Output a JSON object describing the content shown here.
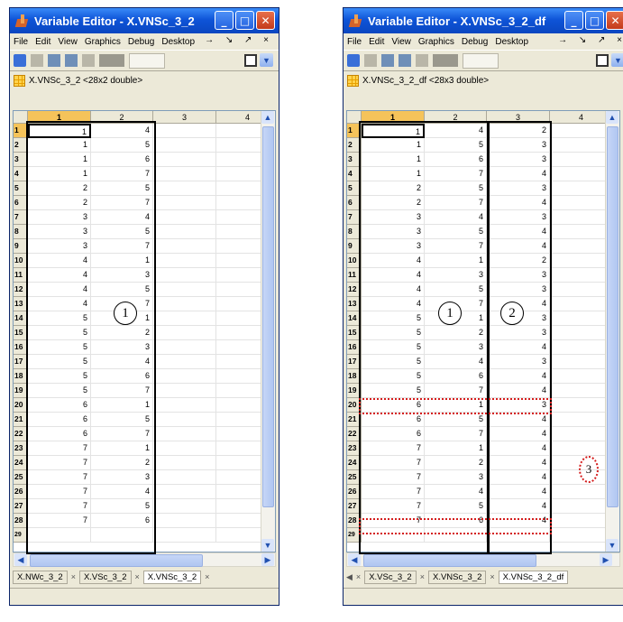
{
  "left": {
    "title": "Variable Editor - X.VNSc_3_2",
    "menu": [
      "File",
      "Edit",
      "View",
      "Graphics",
      "Debug",
      "Desktop"
    ],
    "menu_right": "→ ↘ ↗ ×",
    "var_desc": "X.VNSc_3_2 <28x2 double>",
    "columns": [
      "1",
      "2",
      "3",
      "4"
    ],
    "rows": [
      [
        "1",
        "4"
      ],
      [
        "1",
        "5"
      ],
      [
        "1",
        "6"
      ],
      [
        "1",
        "7"
      ],
      [
        "2",
        "5"
      ],
      [
        "2",
        "7"
      ],
      [
        "3",
        "4"
      ],
      [
        "3",
        "5"
      ],
      [
        "3",
        "7"
      ],
      [
        "4",
        "1"
      ],
      [
        "4",
        "3"
      ],
      [
        "4",
        "5"
      ],
      [
        "4",
        "7"
      ],
      [
        "5",
        "1"
      ],
      [
        "5",
        "2"
      ],
      [
        "5",
        "3"
      ],
      [
        "5",
        "4"
      ],
      [
        "5",
        "6"
      ],
      [
        "5",
        "7"
      ],
      [
        "6",
        "1"
      ],
      [
        "6",
        "5"
      ],
      [
        "6",
        "7"
      ],
      [
        "7",
        "1"
      ],
      [
        "7",
        "2"
      ],
      [
        "7",
        "3"
      ],
      [
        "7",
        "4"
      ],
      [
        "7",
        "5"
      ],
      [
        "7",
        "6"
      ]
    ],
    "tabs": [
      "X.NWc_3_2",
      "X.VSc_3_2",
      "X.VNSc_3_2"
    ],
    "marker1": "1"
  },
  "right": {
    "title": "Variable Editor - X.VNSc_3_2_df",
    "menu": [
      "File",
      "Edit",
      "View",
      "Graphics",
      "Debug",
      "Desktop"
    ],
    "menu_right": "→ ↘ ↗ ×",
    "var_desc": "X.VNSc_3_2_df <28x3 double>",
    "columns": [
      "1",
      "2",
      "3",
      "4"
    ],
    "rows": [
      [
        "1",
        "4",
        "2"
      ],
      [
        "1",
        "5",
        "3"
      ],
      [
        "1",
        "6",
        "3"
      ],
      [
        "1",
        "7",
        "4"
      ],
      [
        "2",
        "5",
        "3"
      ],
      [
        "2",
        "7",
        "4"
      ],
      [
        "3",
        "4",
        "3"
      ],
      [
        "3",
        "5",
        "4"
      ],
      [
        "3",
        "7",
        "4"
      ],
      [
        "4",
        "1",
        "2"
      ],
      [
        "4",
        "3",
        "3"
      ],
      [
        "4",
        "5",
        "3"
      ],
      [
        "4",
        "7",
        "4"
      ],
      [
        "5",
        "1",
        "3"
      ],
      [
        "5",
        "2",
        "3"
      ],
      [
        "5",
        "3",
        "4"
      ],
      [
        "5",
        "4",
        "3"
      ],
      [
        "5",
        "6",
        "4"
      ],
      [
        "5",
        "7",
        "4"
      ],
      [
        "6",
        "1",
        "3"
      ],
      [
        "6",
        "5",
        "4"
      ],
      [
        "6",
        "7",
        "4"
      ],
      [
        "7",
        "1",
        "4"
      ],
      [
        "7",
        "2",
        "4"
      ],
      [
        "7",
        "3",
        "4"
      ],
      [
        "7",
        "4",
        "4"
      ],
      [
        "7",
        "5",
        "4"
      ],
      [
        "7",
        "6",
        "4"
      ]
    ],
    "tabs": [
      "X.VSc_3_2",
      "X.VNSc_3_2",
      "X.VNSc_3_2_df"
    ],
    "marker1": "1",
    "marker2": "2",
    "marker3": "3"
  },
  "icons": [
    "app-icon",
    "minimize-icon",
    "maximize-icon",
    "close-icon",
    "grid-variable-icon"
  ]
}
